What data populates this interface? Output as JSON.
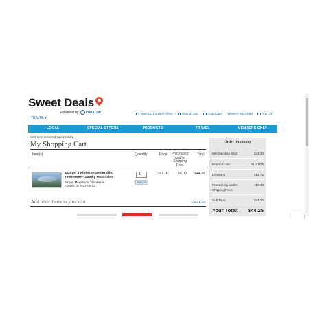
{
  "brand": {
    "name": "Sweet Deals",
    "powered_by": "Powered by",
    "powered_brand": "CURALUB"
  },
  "top_links": [
    {
      "label": "Sign Up for Deal Alerts",
      "icon": "envelope-icon"
    },
    {
      "label": "Search Site",
      "icon": "search-icon"
    },
    {
      "label": "Join/Login",
      "icon": "lock-icon"
    },
    {
      "label": "Where's My Order"
    },
    {
      "label": "Cart (1)",
      "icon": "cart-icon"
    }
  ],
  "travel_dropdown": "TRAVEL ▾",
  "nav": [
    {
      "label": "LOCAL"
    },
    {
      "label": "SPECIAL OFFERS"
    },
    {
      "label": "PRODUCTS"
    },
    {
      "label": "TRAVEL"
    },
    {
      "label": "MEMBERS ONLY"
    }
  ],
  "message": "Cart Item removed successfully.",
  "page_title": "My Shopping Cart",
  "table": {
    "headers": {
      "items": "Item(s)",
      "quantity": "Quantity",
      "price": "Price",
      "processing": "Processing and/or Shipping Fees",
      "total": "Total"
    },
    "rows": [
      {
        "title": "4 Days, 3 Nights In Sevierville, Tennessee - Smoky Mountains",
        "location": "Smoky Mountains, Tennessee",
        "expires": "Expires on 2025-06-12",
        "quantity": "1",
        "remove_label": "Remove",
        "price": "$59.00",
        "processing": "$0.00",
        "total": "$44.25"
      }
    ]
  },
  "add_other": {
    "label": "Add other Items to your cart",
    "view_more": "View More"
  },
  "summary": {
    "title": "Order Summary",
    "merchandise_label": "Merchandise total:",
    "merchandise_value": "$44.25",
    "promo_label": "Promo Code:",
    "promo_value": "SLICK25",
    "discount_label": "Discount:",
    "discount_value": "$14.75",
    "processing_label": "Processing and/or Shipping Fees:",
    "processing_value": "$0.00",
    "subtotal_label": "Sub Total:",
    "subtotal_value": "$44.25",
    "total_label": "Your Total:",
    "total_value": "$44.25"
  },
  "colors": {
    "nav_blue": "#1c9ad6",
    "link_blue": "#1b6fb5",
    "accent_red": "#e8472e",
    "summary_bg": "#e8e8e8"
  }
}
